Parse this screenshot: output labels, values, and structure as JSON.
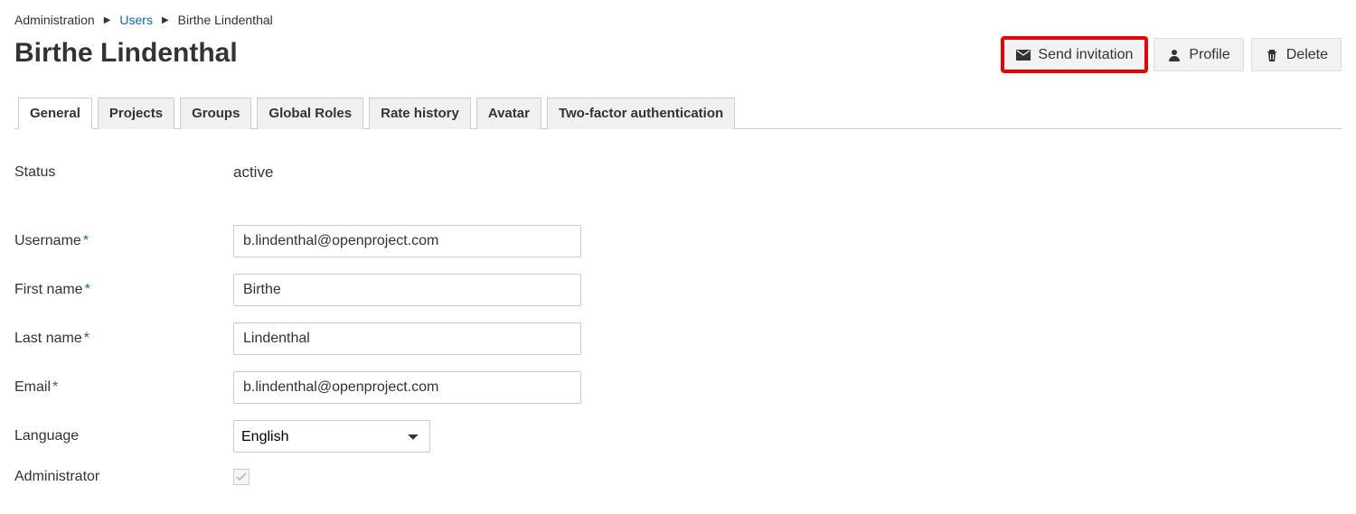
{
  "breadcrumb": {
    "root": "Administration",
    "parent": "Users",
    "current": "Birthe Lindenthal"
  },
  "page": {
    "title": "Birthe Lindenthal"
  },
  "actions": {
    "send_invitation": "Send invitation",
    "profile": "Profile",
    "delete": "Delete"
  },
  "tabs": [
    "General",
    "Projects",
    "Groups",
    "Global Roles",
    "Rate history",
    "Avatar",
    "Two-factor authentication"
  ],
  "form": {
    "status": {
      "label": "Status",
      "value": "active"
    },
    "username": {
      "label": "Username",
      "value": "b.lindenthal@openproject.com"
    },
    "first_name": {
      "label": "First name",
      "value": "Birthe"
    },
    "last_name": {
      "label": "Last name",
      "value": "Lindenthal"
    },
    "email": {
      "label": "Email",
      "value": "b.lindenthal@openproject.com"
    },
    "language": {
      "label": "Language",
      "value": "English"
    },
    "administrator": {
      "label": "Administrator"
    }
  }
}
